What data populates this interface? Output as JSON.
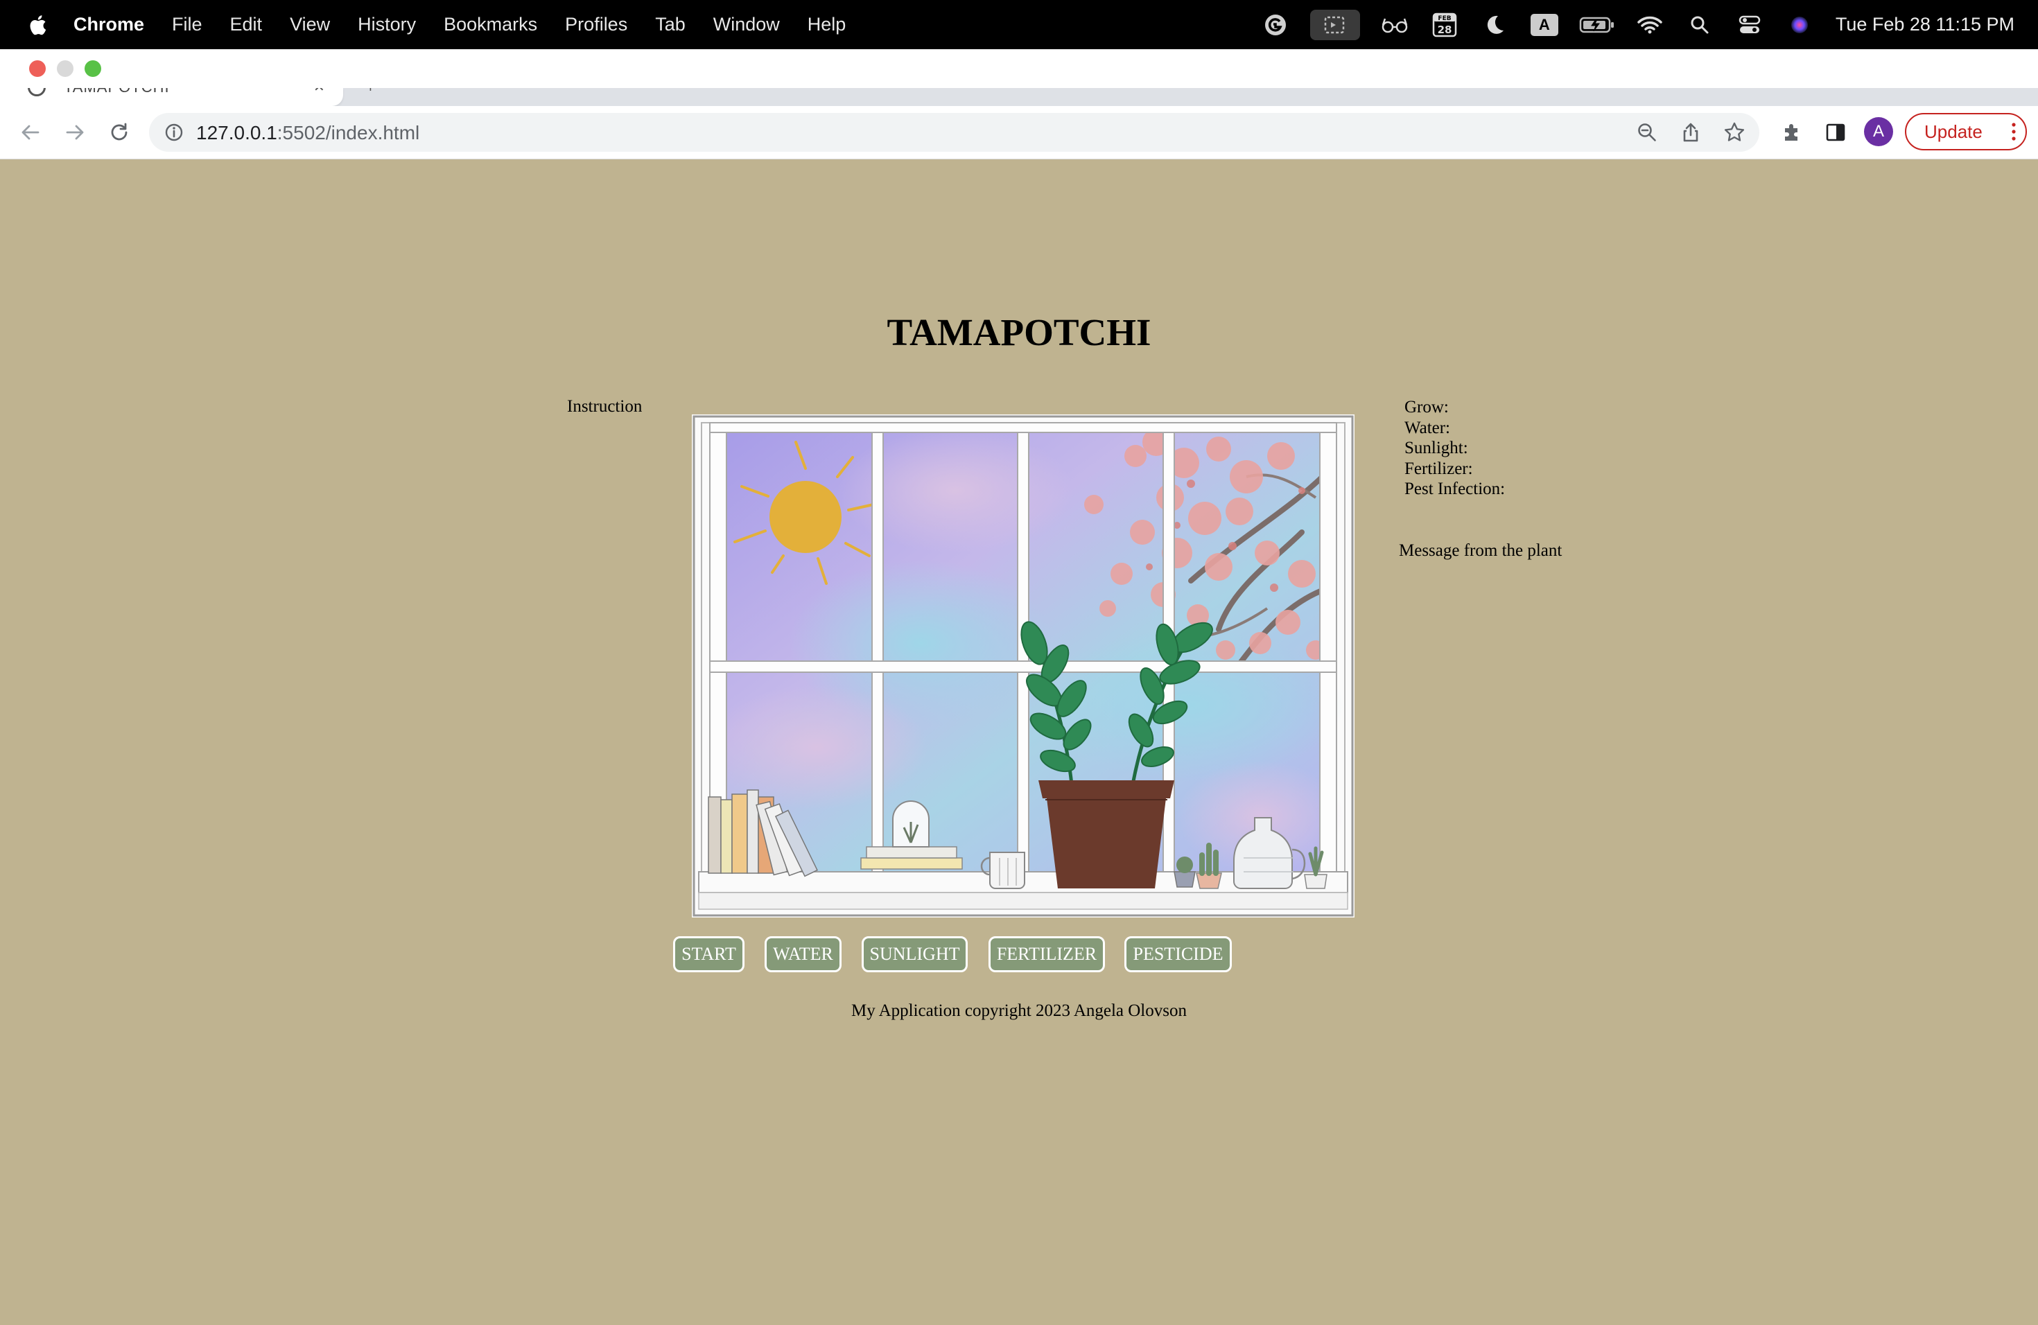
{
  "menubar": {
    "app_name": "Chrome",
    "items": [
      "File",
      "Edit",
      "View",
      "History",
      "Bookmarks",
      "Profiles",
      "Tab",
      "Window",
      "Help"
    ],
    "calendar_month": "FEB",
    "calendar_day": "28",
    "keyboard_indicator": "A",
    "clock": "Tue Feb 28  11:15 PM"
  },
  "browser": {
    "tab_title": "TAMAPOTCHI",
    "url_host": "127.0.0.1",
    "url_rest": ":5502/index.html",
    "avatar_initial": "A",
    "update_label": "Update"
  },
  "page": {
    "title": "TAMAPOTCHI",
    "instruction": "Instruction",
    "stats": {
      "grow": "Grow:",
      "water": "Water:",
      "sunlight": "Sunlight:",
      "fertilizer": "Fertilizer:",
      "pest_infection": "Pest Infection:"
    },
    "message": "Message from the plant",
    "buttons": {
      "start": "START",
      "water": "WATER",
      "sunlight": "SUNLIGHT",
      "fertilizer": "FERTILIZER",
      "pesticide": "PESTICIDE"
    },
    "footer": "My Application copyright 2023 Angela Olovson"
  },
  "colors": {
    "page_background": "#bfb390",
    "button_fill": "#859a78",
    "sun": "#e3b03a",
    "pot": "#6b3a2c",
    "leaf": "#2f8a55",
    "update_red": "#c5221f"
  }
}
